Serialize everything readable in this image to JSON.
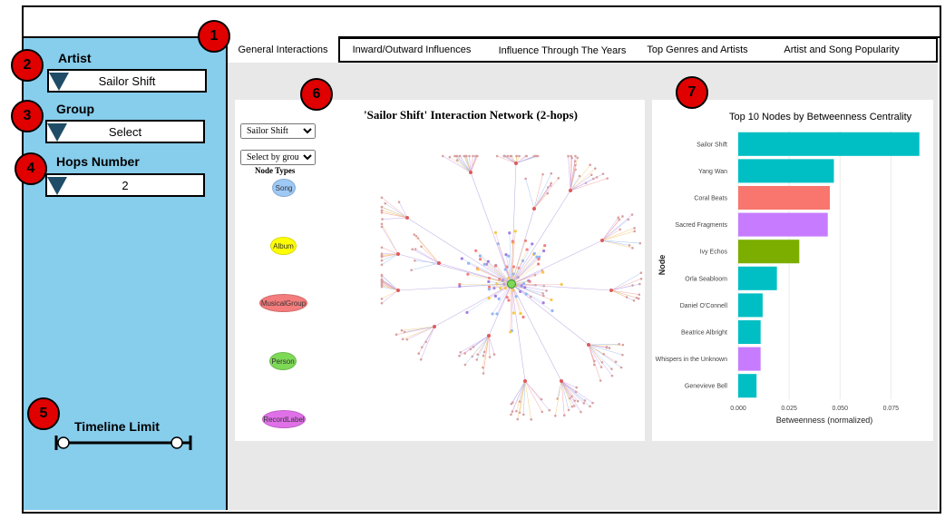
{
  "tabs": [
    {
      "label": "General Interactions",
      "active": true
    },
    {
      "label": "Inward/Outward Influences"
    },
    {
      "label": "Influence Through The Years"
    },
    {
      "label": "Top Genres and Artists"
    },
    {
      "label": "Artist and Song Popularity"
    }
  ],
  "badges": [
    "1",
    "2",
    "3",
    "4",
    "5",
    "6",
    "7"
  ],
  "sidebar": {
    "artist_label": "Artist",
    "artist_value": "Sailor Shift",
    "group_label": "Group",
    "group_value": "Select",
    "hops_label": "Hops Number",
    "hops_value": "2",
    "timeline_label": "Timeline Limit"
  },
  "network": {
    "title": "'Sailor Shift' Interaction Network (2-hops)",
    "artist_select": "Sailor Shift",
    "group_select": "Select by group",
    "node_types_label": "Node Types",
    "node_types": [
      {
        "label": "Song",
        "color": "#9ec9f5"
      },
      {
        "label": "Album",
        "color": "#ffff00"
      },
      {
        "label": "MusicalGroup",
        "color": "#f47c7c"
      },
      {
        "label": "Person",
        "color": "#7ed957"
      },
      {
        "label": "RecordLabel",
        "color": "#e070e8"
      }
    ]
  },
  "chart_data": {
    "type": "bar",
    "orientation": "horizontal",
    "title": "Top 10 Nodes by Betweenness Centrality",
    "xlabel": "Betweenness (normalized)",
    "ylabel": "Node",
    "xlim": [
      0,
      0.09
    ],
    "xticks": [
      "0.000",
      "0.025",
      "0.050",
      "0.075"
    ],
    "categories": [
      "Sailor Shift",
      "Yang Wan",
      "Coral Beats",
      "Sacred Fragments",
      "Ivy Echos",
      "Orla Seabloom",
      "Daniel O'Connell",
      "Beatrice Albright",
      "Whispers in the Unknown",
      "Genevieve Bell"
    ],
    "values": [
      0.089,
      0.047,
      0.045,
      0.044,
      0.03,
      0.019,
      0.012,
      0.011,
      0.011,
      0.009
    ],
    "colors": [
      "#00bfc4",
      "#00bfc4",
      "#f8766d",
      "#c77cff",
      "#7cae00",
      "#00bfc4",
      "#00bfc4",
      "#00bfc4",
      "#c77cff",
      "#00bfc4"
    ],
    "grid": true
  }
}
